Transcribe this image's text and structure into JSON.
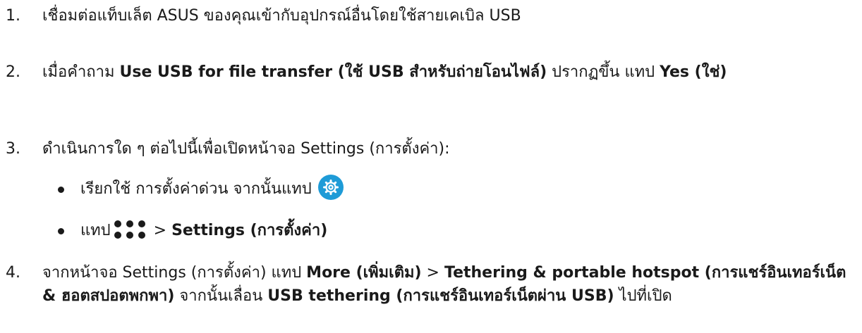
{
  "steps": [
    {
      "number": "1.",
      "text": "เชื่อมต่อแท็บเล็ต ASUS ของคุณเข้ากับอุปกรณ์อื่นโดยใช้สายเคเบิล USB"
    },
    {
      "number": "2.",
      "part1": "เมื่อคำถาม ",
      "bold1": "Use USB for file transfer (ใช้ USB สำหรับถ่ายโอนไฟล์)",
      "part2": " ปรากฏขึ้น แทป ",
      "bold2": "Yes (ใช่)"
    },
    {
      "number": "3.",
      "text": "ดำเนินการใด ๆ ต่อไปนี้เพื่อเปิดหน้าจอ Settings (การตั้งค่า):"
    },
    {
      "number": "4.",
      "part1": "จากหน้าจอ Settings (การตั้งค่า) แทป ",
      "bold1": "More (เพิ่มเติม)",
      "part2": " > ",
      "bold2": "Tethering & portable hotspot (การแชร์อินเทอร์เน็ต & ฮอตสปอตพกพา)",
      "part3": " จากนั้นเลื่อน ",
      "bold3": "USB tethering (การแชร์อินเทอร์เน็ตผ่าน USB)",
      "part4": " ไปที่เปิด"
    }
  ],
  "bullets": [
    {
      "text": "เรียกใช้ การตั้งค่าด่วน จากนั้นแทป",
      "icon": "gear-icon"
    },
    {
      "part1": "แทป",
      "icon": "apps-grid-icon",
      "part2": " > ",
      "bold": "Settings (การตั้งค่า)"
    }
  ],
  "colors": {
    "text": "#1a1a1a",
    "gear_badge": "#1e9bd7"
  }
}
